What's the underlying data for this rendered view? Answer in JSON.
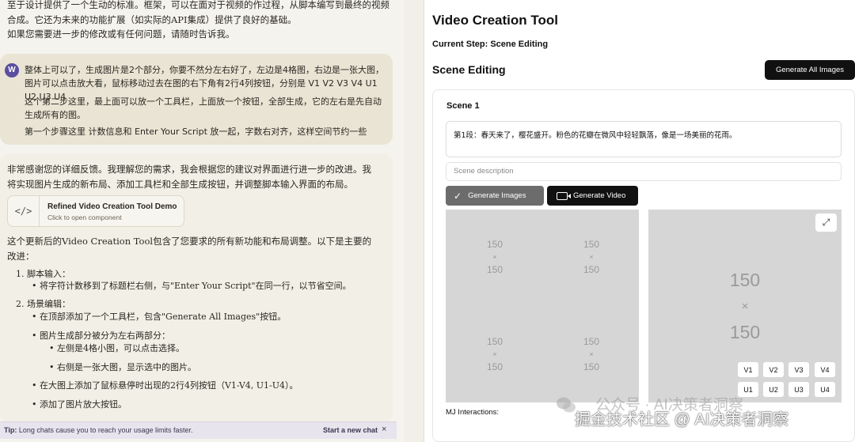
{
  "chat": {
    "top_paragraph_1": "至于设计提供了一个生动的标准。框架，可以在面对于视频的作过程，从脚本编写到最终的视频合成。它还为未来的功能扩展（如实际的API集成）提供了良好的基础。",
    "top_paragraph_2": "如果您需要进一步的修改或有任何问题，请随时告诉我。",
    "user_avatar": "W",
    "user_message_1": "整体上可以了，生成图片是2个部分，你要不然分左右好了，左边是4格图，右边是一张大图，图片可以点击放大看，鼠标移动过去在图的右下角有2行4列按钮，分别是 V1 V2 V3 V4 U1 U2 U3 U4",
    "user_message_2": "这个第二步这里，最上面可以放一个工具栏，上面放一个按钮，全部生成，它的左右是先自动生成所有的图。",
    "user_message_3": "第一个步骤这里 计数信息和 Enter Your Script 放一起，字数右对齐，这样空间节约一些",
    "assistant_intro": "非常感谢您的详细反馈。我理解您的需求，我会根据您的建议对界面进行进一步的改进。我将实现图片生成的新布局、添加工具栏和全部生成按钮，并调整脚本输入界面的布局。",
    "artifact": {
      "icon": "</>",
      "title": "Refined Video Creation Tool Demo",
      "subtitle": "Click to open component"
    },
    "assistant_summary": "这个更新后的Video Creation Tool包含了您要求的所有新功能和布局调整。以下是主要的改进：",
    "list": [
      "1. 脚本输入：",
      "• 将字符计数移到了标题栏右侧，与\"Enter Your Script\"在同一行，以节省空间。",
      "2. 场景编辑：",
      "• 在顶部添加了一个工具栏，包含\"Generate All Images\"按钮。",
      "• 图片生成部分被分为左右两部分：",
      "• 左侧是4格小图，可以点击选择。",
      "• 右侧是一张大图，显示选中的图片。",
      "• 在大图上添加了鼠标悬停时出现的2行4列按钮（V1-V4, U1-U4）。",
      "• 添加了图片放大按钮。"
    ],
    "tip": {
      "label": "Tip:",
      "text": "Long chats cause you to reach your usage limits faster.",
      "new_chat": "Start a new chat",
      "close": "×"
    }
  },
  "app": {
    "title": "Video Creation Tool",
    "current_step": "Current Step: Scene Editing",
    "section_title": "Scene Editing",
    "generate_all_label": "Generate All Images",
    "scene": {
      "title": "Scene 1",
      "script": "第1段：春天来了，樱花盛开。粉色的花瓣在微风中轻轻飘落，像是一场美丽的花雨。",
      "description_placeholder": "Scene description",
      "generate_images_label": "Generate Images",
      "generate_video_label": "Generate Video",
      "thumb_placeholder": {
        "w": "150",
        "x": "×",
        "h": "150"
      },
      "mj_label": "MJ Interactions:",
      "mj_buttons_row1": [
        "V1",
        "V2",
        "V3",
        "V4"
      ],
      "mj_buttons_row2": [
        "U1",
        "U2",
        "U3",
        "U4"
      ]
    }
  },
  "watermark": {
    "line1": "公众号 · AI决策者洞察",
    "line2": "掘金技术社区 @ AI决策者洞察"
  }
}
